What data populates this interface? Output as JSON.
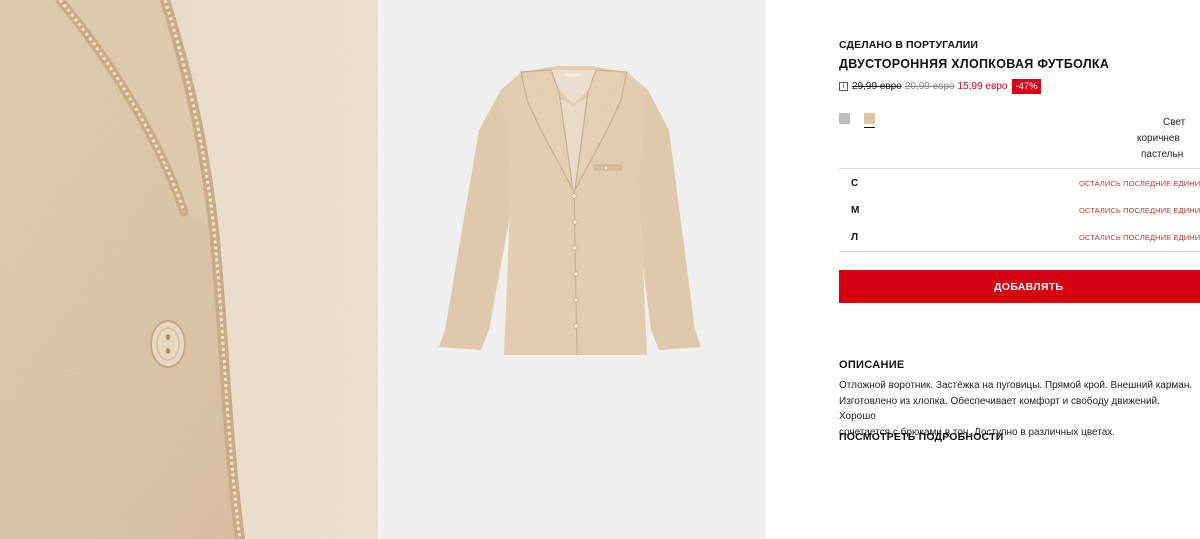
{
  "product": {
    "origin": "СДЕЛАНО В ПОРТУГАЛИИ",
    "title": "ДВУСТОРОННЯЯ ХЛОПКОВАЯ ФУТБОЛКА",
    "info_icon": "i",
    "price_original": "29,99 евро",
    "price_previous": "20,99 евро",
    "price_current": "15,99 евро",
    "discount": "-47%"
  },
  "colors": {
    "swatches": [
      {
        "name": "grey-swatch",
        "hex": "#bdbdbd"
      },
      {
        "name": "beige-swatch",
        "hex": "#dfc7a8"
      }
    ],
    "selected_name_line1": "Свет",
    "selected_name_line2": "коричнев",
    "selected_name_line3": "пастельн",
    "accent": "#d70010"
  },
  "sizes": [
    {
      "label": "С",
      "status": "ОСТАЛИСЬ ПОСЛЕДНИЕ ЕДИНИЦЫ!"
    },
    {
      "label": "М",
      "status": "ОСТАЛИСЬ ПОСЛЕДНИЕ ЕДИНИЦЫ!"
    },
    {
      "label": "Л",
      "status": "ОСТАЛИСЬ ПОСЛЕДНИЕ ЕДИНИЦЫ!"
    }
  ],
  "actions": {
    "add_label": "ДОБАВЛЯТЬ",
    "details_label": "ПОСМОТРЕТЬ ПОДРОБНОСТИ"
  },
  "description": {
    "title": "ОПИСАНИЕ",
    "line1": "Отложной воротник. Застёжка на пуговицы. Прямой крой. Внешний карман.",
    "line2": "Изготовлено из хлопка. Обеспечивает комфорт и свободу движений. Хорошо",
    "line3": "сочетается с брюками в тон. Доступно в различных цветах."
  }
}
